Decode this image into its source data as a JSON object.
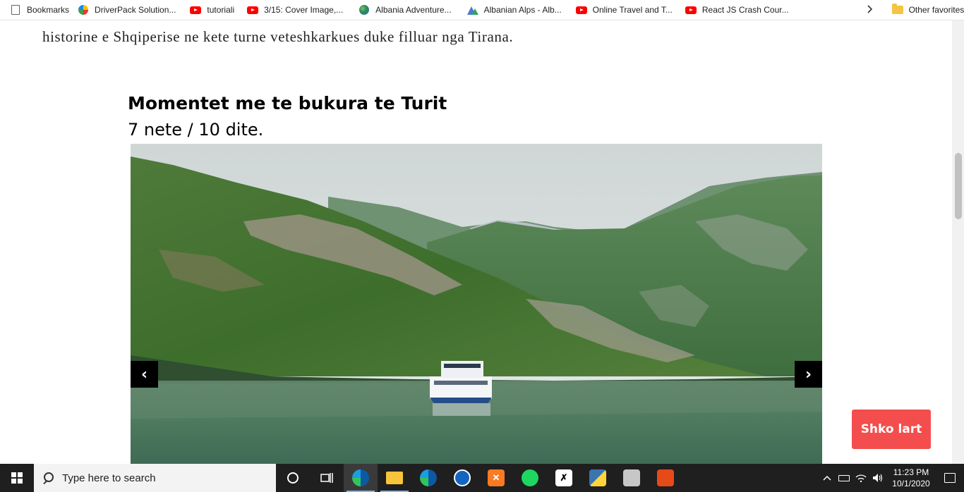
{
  "bookmarks": {
    "items": [
      {
        "label": "Bookmarks",
        "icon": "page-icon"
      },
      {
        "label": "DriverPack Solution...",
        "icon": "driverpack-icon"
      },
      {
        "label": "tutoriali",
        "icon": "youtube-icon"
      },
      {
        "label": "3/15: Cover Image,...",
        "icon": "youtube-icon"
      },
      {
        "label": "Albania Adventure...",
        "icon": "globe-icon"
      },
      {
        "label": "Albanian Alps - Alb...",
        "icon": "mountains-icon"
      },
      {
        "label": "Online Travel and T...",
        "icon": "youtube-icon"
      },
      {
        "label": "React JS Crash Cour...",
        "icon": "youtube-icon"
      }
    ],
    "overflow_icon": "chevron-right-icon",
    "other_favorites": "Other favorites"
  },
  "page": {
    "intro_text": "historine e Shqiperise ne kete turne veteshkarkues duke filluar nga Tirana.",
    "section_title": "Momentet me te bukura te Turit",
    "section_subtitle": "7 nete / 10 dite.",
    "carousel": {
      "prev_label": "‹",
      "next_label": "›",
      "image_description_icon": "lake-landscape-image"
    },
    "scroll_top_label": "Shko lart"
  },
  "taskbar": {
    "search_placeholder": "Type here to search",
    "apps": [
      {
        "name": "cortana",
        "icon": "circle-icon"
      },
      {
        "name": "task-view",
        "icon": "task-view-icon"
      },
      {
        "name": "edge",
        "icon": "edge-icon",
        "active": true
      },
      {
        "name": "file-explorer",
        "icon": "folder-icon"
      },
      {
        "name": "edge-beta",
        "icon": "edge-beta-icon"
      },
      {
        "name": "app-blue",
        "icon": "app-icon"
      },
      {
        "name": "xampp",
        "icon": "xampp-icon"
      },
      {
        "name": "spotify",
        "icon": "spotify-icon"
      },
      {
        "name": "counter-strike",
        "icon": "cs-icon"
      },
      {
        "name": "python",
        "icon": "python-icon"
      },
      {
        "name": "app-box",
        "icon": "box-icon"
      },
      {
        "name": "app-red",
        "icon": "tool-icon"
      }
    ],
    "clock_time": "11:23 PM",
    "clock_date": "10/1/2020"
  },
  "colors": {
    "scroll_top_bg": "#f44d4d",
    "taskbar_bg": "#1f1f1f",
    "carousel_btn_bg": "#000000"
  }
}
